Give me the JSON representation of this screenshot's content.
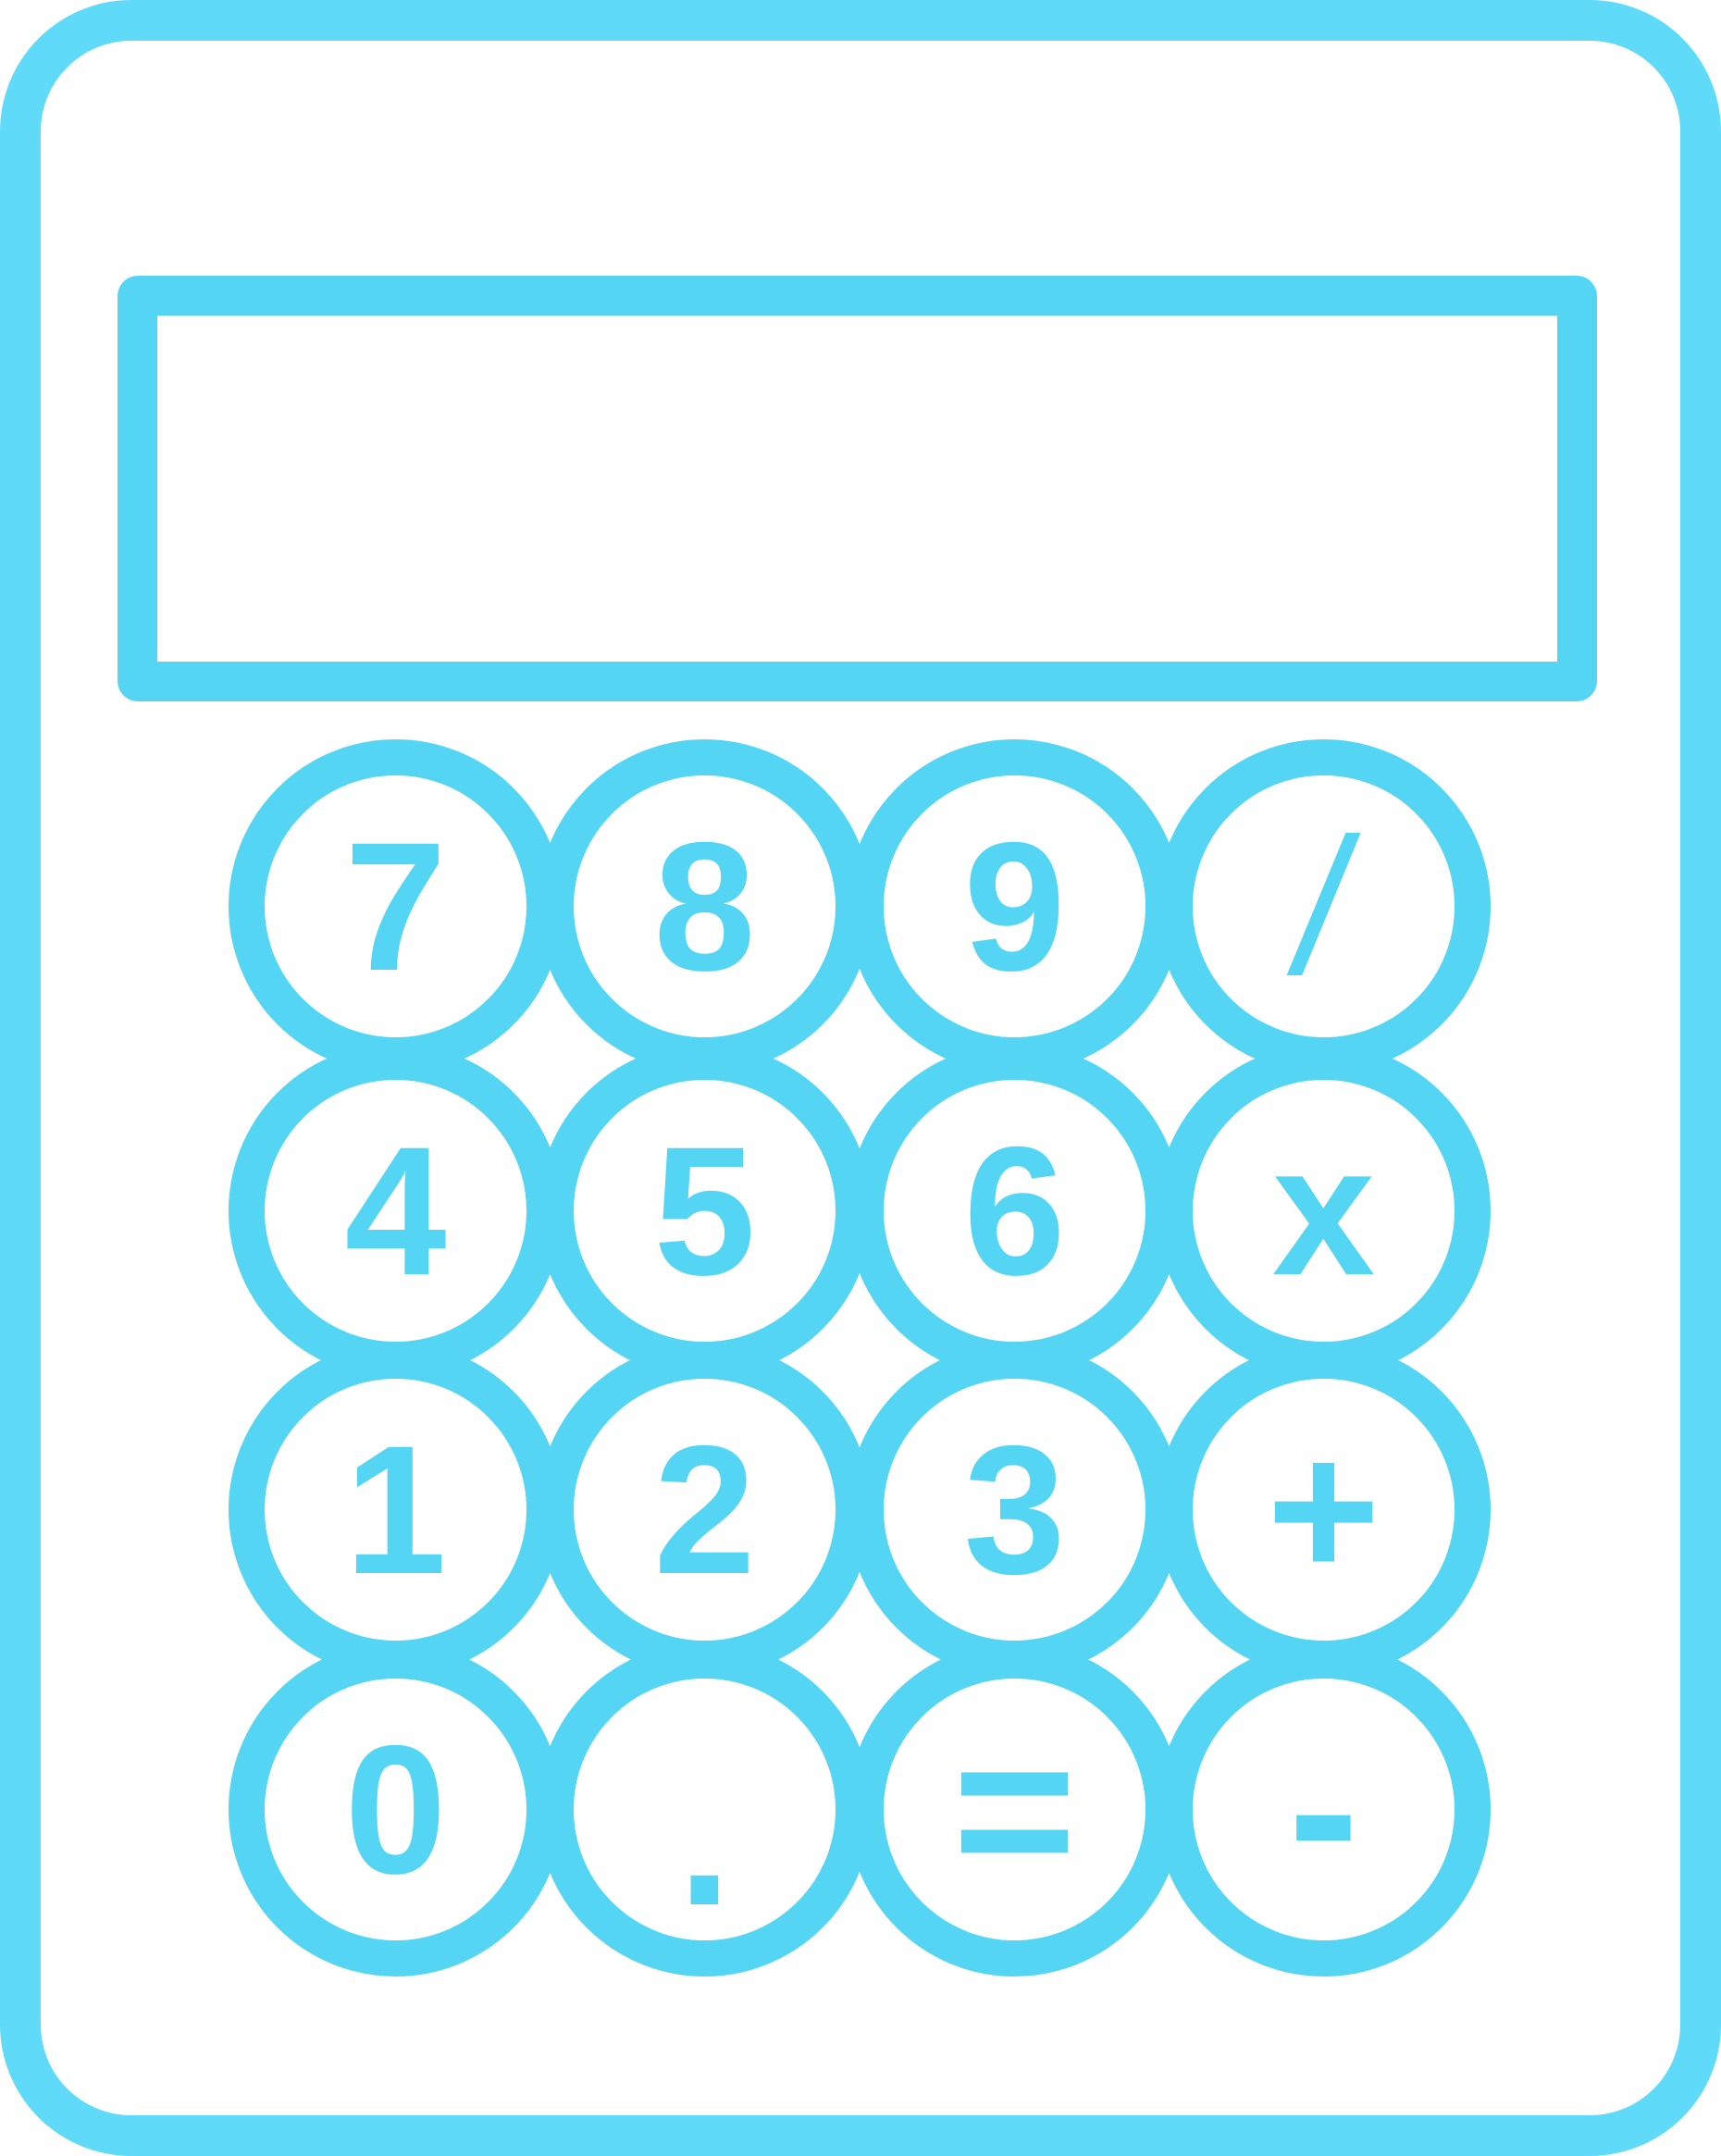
{
  "calculator": {
    "display_value": "",
    "keys": [
      {
        "label": "7"
      },
      {
        "label": "8"
      },
      {
        "label": "9"
      },
      {
        "label": "/"
      },
      {
        "label": "4"
      },
      {
        "label": "5"
      },
      {
        "label": "6"
      },
      {
        "label": "x"
      },
      {
        "label": "1"
      },
      {
        "label": "2"
      },
      {
        "label": "3"
      },
      {
        "label": "+"
      },
      {
        "label": "0"
      },
      {
        "label": "."
      },
      {
        "label": "="
      },
      {
        "label": "-"
      }
    ]
  },
  "colors": {
    "outline": "#5fdbf9",
    "keys": "#55d5f4",
    "background": "#ffffff"
  }
}
